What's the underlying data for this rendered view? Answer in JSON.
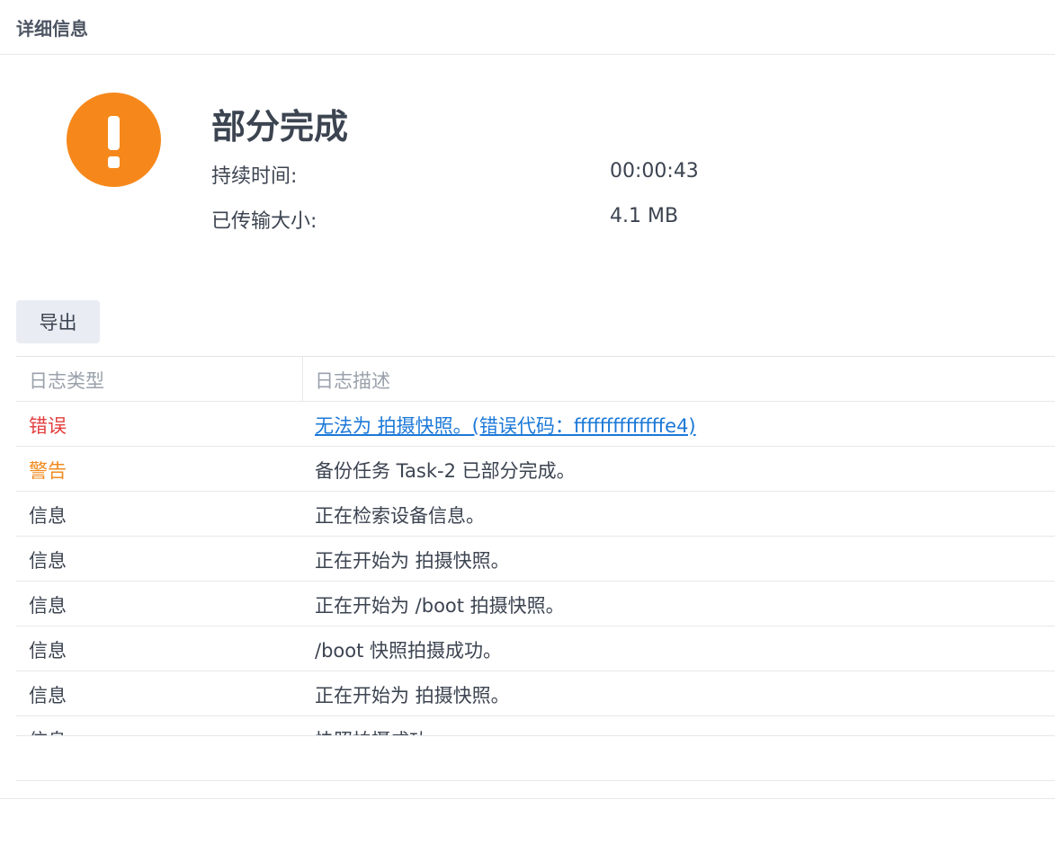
{
  "header": {
    "title": "详细信息"
  },
  "status": {
    "icon": "warning-exclamation-icon",
    "icon_color": "#f6881b",
    "title": "部分完成",
    "details": [
      {
        "label": "持续时间:",
        "value": "00:00:43"
      },
      {
        "label": "已传输大小:",
        "value": "4.1 MB"
      }
    ]
  },
  "toolbar": {
    "export_label": "导出"
  },
  "log_table": {
    "columns": {
      "type": "日志类型",
      "description": "日志描述"
    },
    "rows": [
      {
        "type": "错误",
        "level": "error",
        "description": "无法为 拍摄快照。(错误代码：ffffffffffffffe4)",
        "is_link": true
      },
      {
        "type": "警告",
        "level": "warning",
        "description": "备份任务 Task-2 已部分完成。",
        "is_link": false
      },
      {
        "type": "信息",
        "level": "info",
        "description": "正在检索设备信息。",
        "is_link": false
      },
      {
        "type": "信息",
        "level": "info",
        "description": "正在开始为 拍摄快照。",
        "is_link": false
      },
      {
        "type": "信息",
        "level": "info",
        "description": "正在开始为 /boot 拍摄快照。",
        "is_link": false
      },
      {
        "type": "信息",
        "level": "info",
        "description": "/boot 快照拍摄成功。",
        "is_link": false
      },
      {
        "type": "信息",
        "level": "info",
        "description": "正在开始为 拍摄快照。",
        "is_link": false
      },
      {
        "type": "信息",
        "level": "info",
        "description": "快照拍摄成功。",
        "is_link": false
      }
    ]
  },
  "colors": {
    "error": "#e23d3d",
    "warning": "#ef8b1f",
    "link": "#1b78d8"
  }
}
